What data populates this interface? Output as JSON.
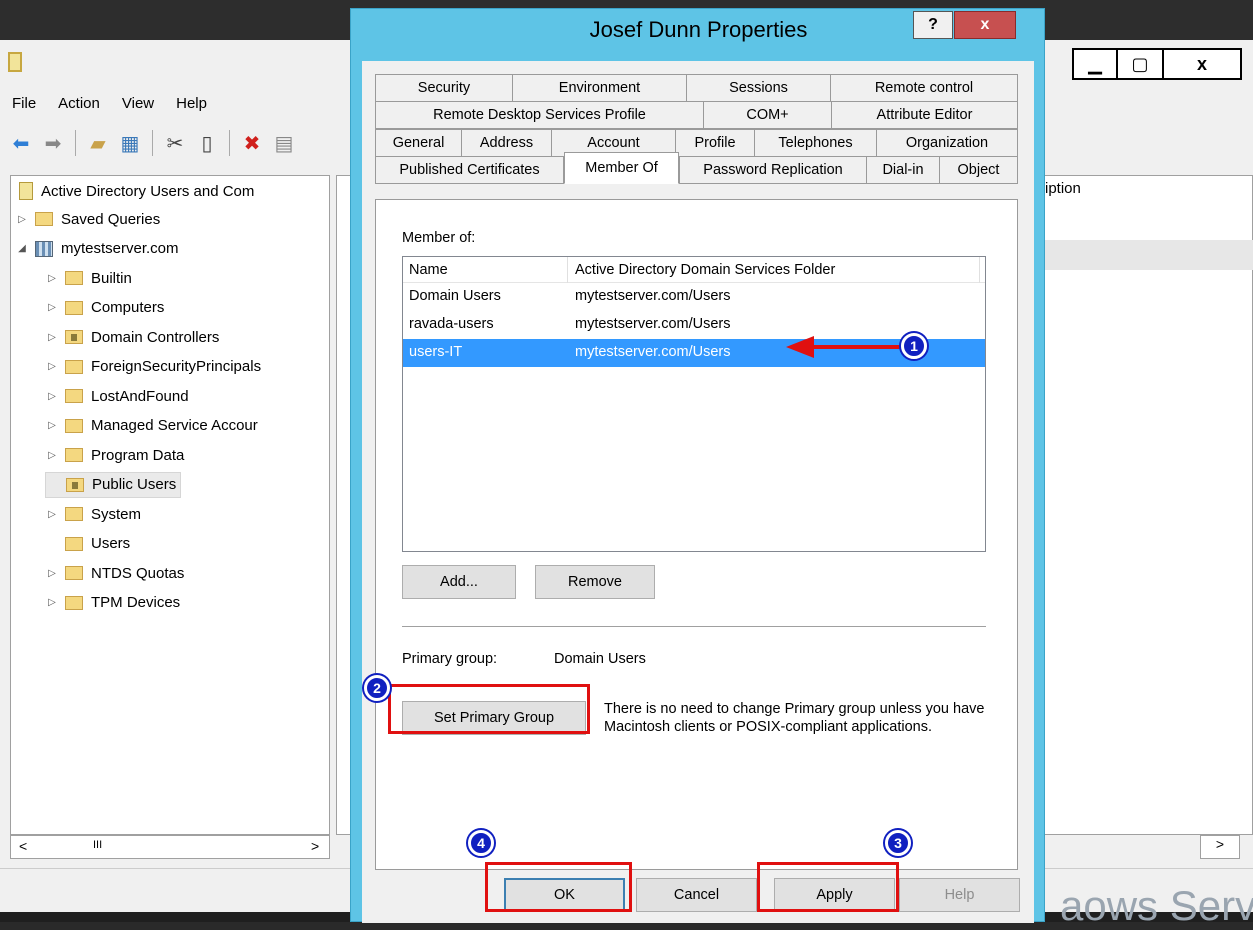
{
  "background_window": {
    "menu": [
      "File",
      "Action",
      "View",
      "Help"
    ],
    "close_glyph": "x",
    "tree": {
      "root": "Active Directory Users and Com",
      "items": [
        {
          "label": "Saved Queries",
          "indent": 1,
          "expander": "▷"
        },
        {
          "label": "mytestserver.com",
          "indent": 1,
          "expander": "◢"
        },
        {
          "label": "Builtin",
          "indent": 2,
          "expander": "▷"
        },
        {
          "label": "Computers",
          "indent": 2,
          "expander": "▷"
        },
        {
          "label": "Domain Controllers",
          "indent": 2,
          "expander": "▷"
        },
        {
          "label": "ForeignSecurityPrincipals",
          "indent": 2,
          "expander": "▷"
        },
        {
          "label": "LostAndFound",
          "indent": 2,
          "expander": "▷"
        },
        {
          "label": "Managed Service Accour",
          "indent": 2,
          "expander": "▷"
        },
        {
          "label": "Program Data",
          "indent": 2,
          "expander": "▷"
        },
        {
          "label": "Public Users",
          "indent": 2,
          "expander": ""
        },
        {
          "label": "System",
          "indent": 2,
          "expander": "▷"
        },
        {
          "label": "Users",
          "indent": 2,
          "expander": ""
        },
        {
          "label": "NTDS Quotas",
          "indent": 2,
          "expander": "▷"
        },
        {
          "label": "TPM Devices",
          "indent": 2,
          "expander": "▷"
        }
      ]
    },
    "right_column_header": "ription",
    "scroll_left": "<",
    "scroll_thumb": "III",
    "scroll_right": ">",
    "watermark": "aows Serv"
  },
  "dialog": {
    "title": "Josef Dunn Properties",
    "help_glyph": "?",
    "close_glyph": "x",
    "tabs_row1": [
      "Security",
      "Environment",
      "Sessions",
      "Remote control"
    ],
    "tabs_row2": [
      "Remote Desktop Services Profile",
      "COM+",
      "Attribute Editor"
    ],
    "tabs_row3": [
      "General",
      "Address",
      "Account",
      "Profile",
      "Telephones",
      "Organization"
    ],
    "tabs_row4": [
      "Published Certificates",
      "Member Of",
      "Password Replication",
      "Dial-in",
      "Object"
    ],
    "active_tab": "Member Of",
    "member_of_label": "Member of:",
    "list_columns": [
      "Name",
      "Active Directory Domain Services Folder"
    ],
    "list_rows": [
      {
        "name": "Domain Users",
        "folder": "mytestserver.com/Users"
      },
      {
        "name": "ravada-users",
        "folder": "mytestserver.com/Users"
      },
      {
        "name": "users-IT",
        "folder": "mytestserver.com/Users"
      }
    ],
    "add_button": "Add...",
    "remove_button": "Remove",
    "primary_group_label": "Primary group:",
    "primary_group_value": "Domain Users",
    "set_primary_button": "Set Primary Group",
    "hint": "There is no need to change Primary group unless you have Macintosh clients or POSIX-compliant applications.",
    "ok_button": "OK",
    "cancel_button": "Cancel",
    "apply_button": "Apply",
    "help_button": "Help"
  },
  "annotations": {
    "badge_1": "1",
    "badge_2": "2",
    "badge_3": "3",
    "badge_4": "4",
    "highlight_color": "#e01010",
    "badge_color": "#1020c0"
  }
}
